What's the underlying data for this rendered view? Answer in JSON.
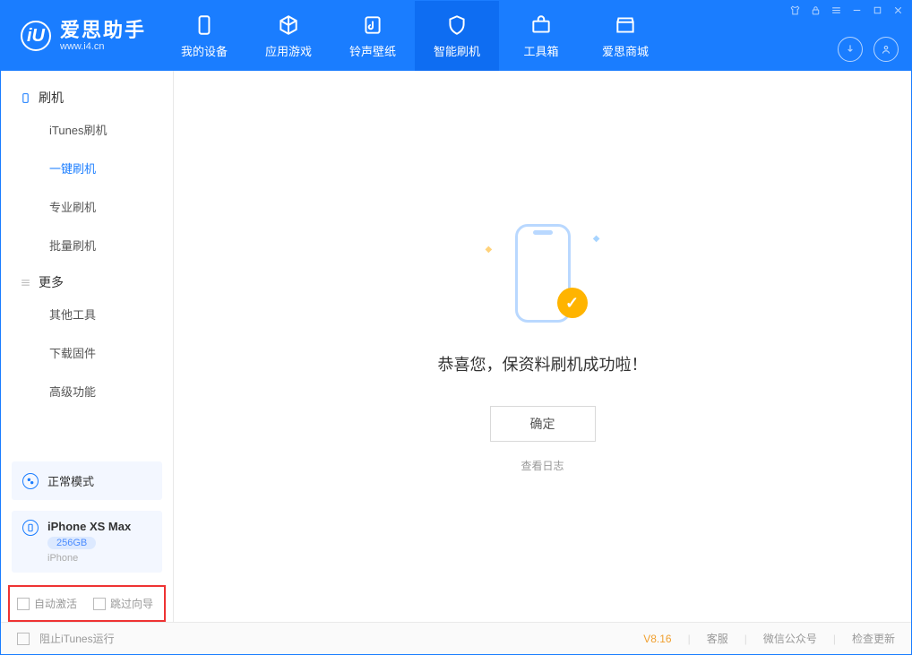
{
  "app": {
    "title": "爱思助手",
    "sub": "www.i4.cn"
  },
  "tabs": {
    "device": "我的设备",
    "apps": "应用游戏",
    "ring": "铃声壁纸",
    "flash": "智能刷机",
    "toolbox": "工具箱",
    "store": "爱思商城"
  },
  "sidebar": {
    "group_flash": "刷机",
    "items_flash": [
      "iTunes刷机",
      "一键刷机",
      "专业刷机",
      "批量刷机"
    ],
    "active_flash_index": 1,
    "group_more": "更多",
    "items_more": [
      "其他工具",
      "下载固件",
      "高级功能"
    ]
  },
  "mode": {
    "label": "正常模式"
  },
  "device": {
    "name": "iPhone XS Max",
    "capacity": "256GB",
    "type": "iPhone"
  },
  "options": {
    "auto_activate": "自动激活",
    "skip_guide": "跳过向导"
  },
  "main": {
    "message": "恭喜您，保资料刷机成功啦！",
    "ok": "确定",
    "view_log": "查看日志"
  },
  "status": {
    "block_itunes": "阻止iTunes运行",
    "version": "V8.16",
    "support": "客服",
    "wechat": "微信公众号",
    "update": "检查更新"
  }
}
